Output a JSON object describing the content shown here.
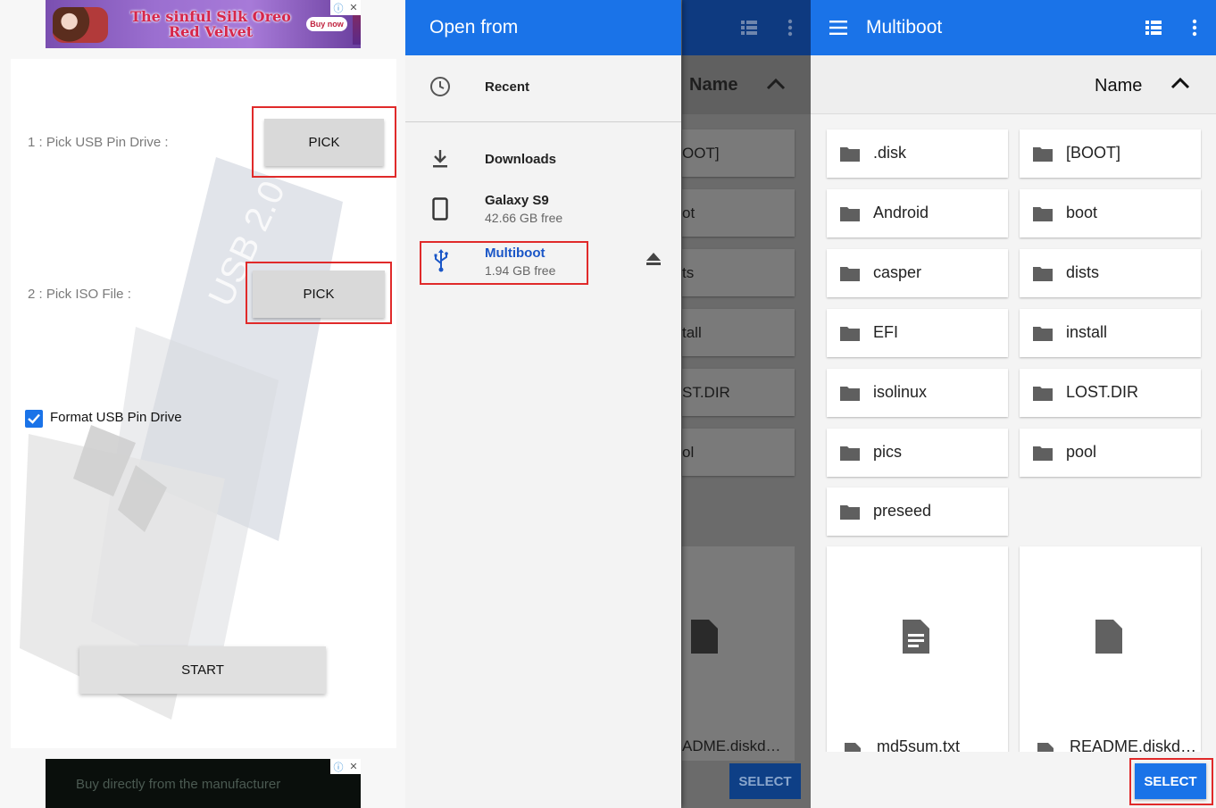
{
  "ads": {
    "top_headline": "The sinful Silk Oreo Red Velvet",
    "top_cta": "Buy now",
    "bottom_text": "Buy directly from the manufacturer"
  },
  "app": {
    "step1_label": "1 : Pick USB Pin Drive :",
    "step2_label": "2 : Pick ISO File :",
    "pick1_label": "PICK",
    "pick2_label": "PICK",
    "format_label": "Format USB Pin Drive",
    "format_checked": true,
    "start_label": "START",
    "art_text": "USB 2.0"
  },
  "drawer": {
    "title": "Open from",
    "items": [
      {
        "icon": "clock-icon",
        "title": "Recent",
        "subtitle": ""
      },
      {
        "icon": "download-icon",
        "title": "Downloads",
        "subtitle": ""
      },
      {
        "icon": "phone-icon",
        "title": "Galaxy S9",
        "subtitle": "42.66 GB free"
      },
      {
        "icon": "usb-icon",
        "title": "Multiboot",
        "subtitle": "1.94 GB free"
      }
    ]
  },
  "background_partial": {
    "sort_label": "Name",
    "items": [
      "OOT]",
      "ot",
      "ts",
      "tall",
      "ST.DIR",
      "ol"
    ],
    "file_name": "ADME.diskd…",
    "select_label": "SELECT"
  },
  "browser": {
    "title": "Multiboot",
    "sort_label": "Name",
    "folders": [
      ".disk",
      "[BOOT]",
      "Android",
      "boot",
      "casper",
      "dists",
      "EFI",
      "install",
      "isolinux",
      "LOST.DIR",
      "pics",
      "pool",
      "preseed"
    ],
    "files": [
      "md5sum.txt",
      "README.diskd…"
    ],
    "select_label": "SELECT"
  },
  "colors": {
    "primary": "#1a73e8",
    "highlight": "#e02a2a",
    "usb_accent": "#1a56c7"
  }
}
